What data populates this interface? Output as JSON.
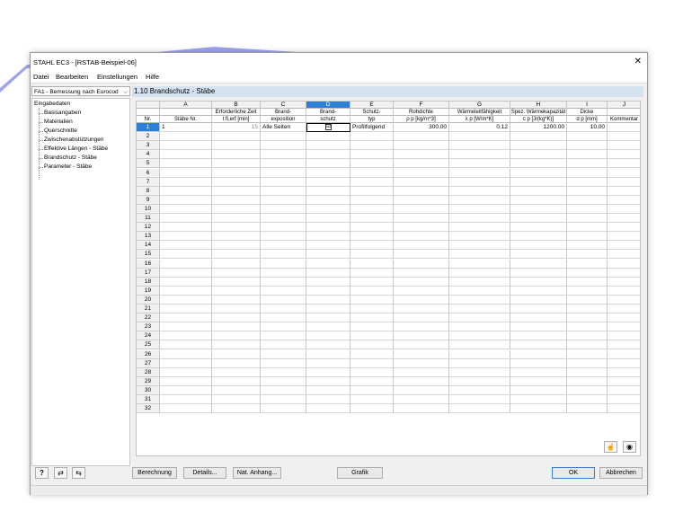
{
  "window": {
    "title": "STAHL EC3 - [RSTAB-Beispiel-06]",
    "close_glyph": "✕"
  },
  "menubar": {
    "items": [
      "Datei",
      "Bearbeiten",
      "Einstellungen",
      "Hilfe"
    ]
  },
  "module_select": {
    "value": "FA1 - Bemessung nach Eurocod",
    "chevron": "⌵"
  },
  "nav": {
    "root": "Eingabedaten",
    "items": [
      "Basisangaben",
      "Materialien",
      "Querschnitte",
      "Zwischenabstützungen",
      "Effektive Längen - Stäbe",
      "Brandschutz - Stäbe",
      "Parameter - Stäbe"
    ]
  },
  "table": {
    "title": "1.10 Brandschutz - Stäbe",
    "rownum_header": "Nr.",
    "columns": [
      {
        "letter": "A",
        "line1": "",
        "line2": "Stäbe Nr."
      },
      {
        "letter": "B",
        "line1": "Erforderliche Zeit",
        "line2": "t fi,erf [min]"
      },
      {
        "letter": "C",
        "line1": "Brand-",
        "line2": "exposition"
      },
      {
        "letter": "D",
        "line1": "Brand-",
        "line2": "schutz"
      },
      {
        "letter": "E",
        "line1": "Schutz-",
        "line2": "typ"
      },
      {
        "letter": "F",
        "line1": "Rohdichte",
        "line2": "ρ p [kg/m^3]"
      },
      {
        "letter": "G",
        "line1": "Wärmeleitfähigkeit",
        "line2": "λ p [W/m*K]"
      },
      {
        "letter": "H",
        "line1": "Spez. Wärmekapazität",
        "line2": "c p [J/(kg*K)]"
      },
      {
        "letter": "I",
        "line1": "Dicke",
        "line2": "d p [mm]"
      },
      {
        "letter": "J",
        "line1": "",
        "line2": "Kommentar"
      }
    ],
    "row1": {
      "members": "1",
      "time": "15",
      "exposure": "Alle Seiten",
      "protection_checked": "☑",
      "type": "Profilfolgend",
      "density": "300.00",
      "conductivity": "0.12",
      "capacity": "1200.00",
      "thickness": "10.00",
      "comment": ""
    },
    "row_numbers": [
      "1",
      "2",
      "3",
      "4",
      "5",
      "6",
      "7",
      "8",
      "9",
      "10",
      "11",
      "12",
      "13",
      "14",
      "15",
      "16",
      "17",
      "18",
      "19",
      "20",
      "21",
      "22",
      "23",
      "24",
      "25",
      "26",
      "27",
      "28",
      "29",
      "30",
      "31",
      "32"
    ]
  },
  "table_tools": {
    "pick_icon": "pointer-hand-icon",
    "view_icon": "eye-icon",
    "pick_glyph": "☝",
    "view_glyph": "◉"
  },
  "bottom_icons": {
    "help_glyph": "?",
    "export_glyph": "⇄",
    "import_glyph": "⇆"
  },
  "buttons": {
    "calculation": "Berechnung",
    "details": "Details...",
    "national_annex": "Nat. Anhang...",
    "graphics": "Grafik",
    "ok": "OK",
    "cancel": "Abbrechen"
  },
  "colors": {
    "accent": "#2e7fd6",
    "table_header_bg": "#d5e3f1",
    "background_shape": "#8f94e8"
  }
}
